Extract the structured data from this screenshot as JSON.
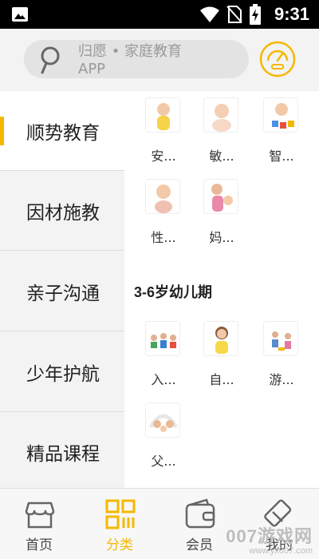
{
  "status_bar": {
    "time": "9:31"
  },
  "search": {
    "placeholder_line1": "归愿 • 家庭教育",
    "placeholder_line2": "APP"
  },
  "sidebar": {
    "items": [
      {
        "label": "顺势教育",
        "active": true
      },
      {
        "label": "因材施教",
        "active": false
      },
      {
        "label": "亲子沟通",
        "active": false
      },
      {
        "label": "少年护航",
        "active": false
      },
      {
        "label": "精品课程",
        "active": false
      }
    ]
  },
  "content": {
    "group1": [
      "安...",
      "敏...",
      "智...",
      "性...",
      "妈..."
    ],
    "section2_title": "3-6岁幼儿期",
    "group2": [
      "入...",
      "自...",
      "游...",
      "父..."
    ]
  },
  "bottom_nav": {
    "items": [
      {
        "label": "首页",
        "icon": "shop-icon"
      },
      {
        "label": "分类",
        "icon": "grid-icon",
        "active": true
      },
      {
        "label": "会员",
        "icon": "wallet-icon"
      },
      {
        "label": "我的",
        "icon": "eraser-icon"
      }
    ]
  },
  "watermark": {
    "text": "007游戏网",
    "url": "www.yx007.com"
  },
  "colors": {
    "accent": "#f5b800"
  }
}
